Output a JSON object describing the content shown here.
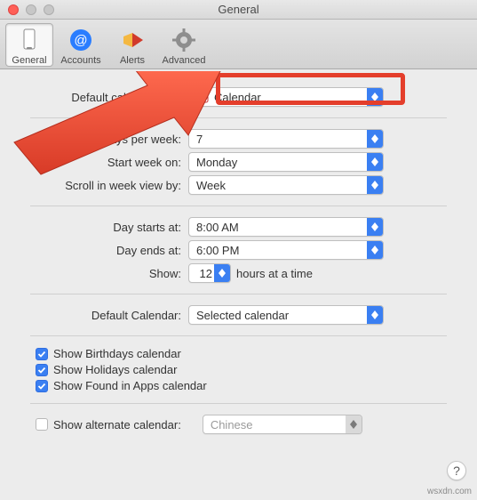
{
  "window": {
    "title": "General"
  },
  "toolbar": {
    "items": [
      {
        "label": "General"
      },
      {
        "label": "Accounts"
      },
      {
        "label": "Alerts"
      },
      {
        "label": "Advanced"
      }
    ]
  },
  "settings": {
    "default_app_label": "Default calendar app:",
    "default_app_value": "Calendar",
    "days_per_week_label": "Days per week:",
    "days_per_week_value": "7",
    "start_week_label": "Start week on:",
    "start_week_value": "Monday",
    "scroll_view_label": "Scroll in week view by:",
    "scroll_view_value": "Week",
    "day_starts_label": "Day starts at:",
    "day_starts_value": "8:00 AM",
    "day_ends_label": "Day ends at:",
    "day_ends_value": "6:00 PM",
    "show_label": "Show:",
    "show_value": "12",
    "show_suffix": "hours at a time",
    "default_cal_label": "Default Calendar:",
    "default_cal_value": "Selected calendar"
  },
  "checks": {
    "birthdays": "Show Birthdays calendar",
    "holidays": "Show Holidays calendar",
    "found": "Show Found in Apps calendar",
    "alternate": "Show alternate calendar:"
  },
  "alternate_value": "Chinese",
  "help": "?",
  "watermark": "wsxdn.com"
}
